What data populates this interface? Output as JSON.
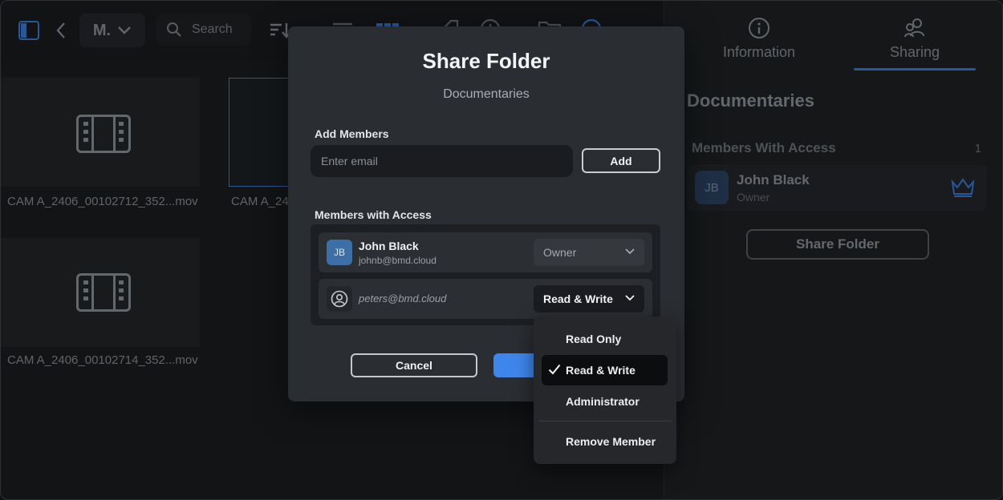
{
  "toolbar": {
    "breadcrumb_label": "M.",
    "search_placeholder": "Search"
  },
  "grid": {
    "items": [
      {
        "name": "CAM A_2406_00102712_352...mov"
      },
      {
        "name": "CAM A_24"
      },
      {
        "name": "CAM A_2406_00102714_352...mov"
      }
    ]
  },
  "panel": {
    "tabs": [
      {
        "label": "Information"
      },
      {
        "label": "Sharing"
      }
    ],
    "folder_title": "Documentaries",
    "members_heading": "Members With Access",
    "members_count": "1",
    "member": {
      "initials": "JB",
      "name": "John Black",
      "role": "Owner"
    },
    "share_button": "Share Folder"
  },
  "modal": {
    "title": "Share Folder",
    "subtitle": "Documentaries",
    "add_members_label": "Add Members",
    "email_placeholder": "Enter email",
    "add_button": "Add",
    "members_label": "Members with Access",
    "members": [
      {
        "initials": "JB",
        "name": "John Black",
        "email": "johnb@bmd.cloud",
        "role": "Owner"
      },
      {
        "email": "peters@bmd.cloud",
        "role": "Read & Write"
      }
    ],
    "cancel_button": "Cancel"
  },
  "dropdown": {
    "items": [
      {
        "label": "Read Only"
      },
      {
        "label": "Read & Write",
        "selected": true
      },
      {
        "label": "Administrator"
      },
      {
        "label": "Remove Member"
      }
    ]
  },
  "colors": {
    "accent": "#3f86ec",
    "modal_bg": "#2a2d31",
    "avatar": "#3b6fa6"
  }
}
